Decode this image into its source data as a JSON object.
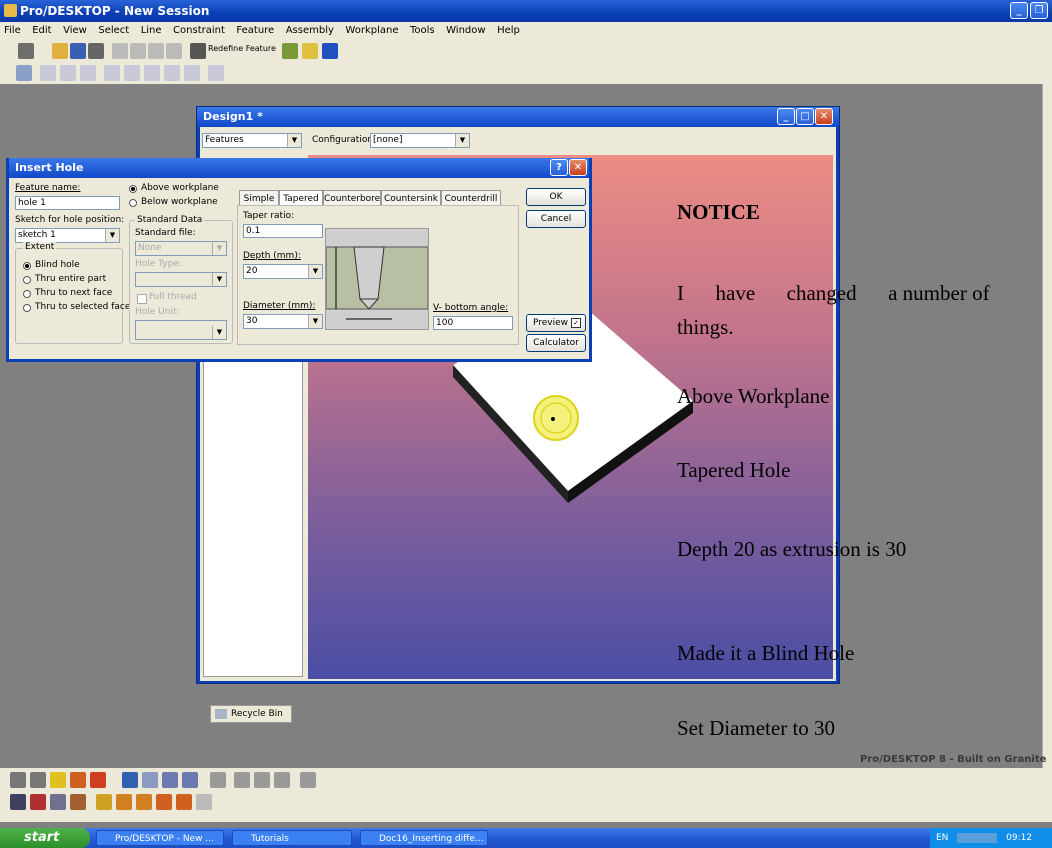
{
  "app": {
    "title": "Pro/DESKTOP - New Session"
  },
  "menu": [
    "File",
    "Edit",
    "View",
    "Select",
    "Line",
    "Constraint",
    "Feature",
    "Assembly",
    "Workplane",
    "Tools",
    "Window",
    "Help"
  ],
  "toolbar": {
    "redefine_label": "Redefine Feature"
  },
  "design_window": {
    "title": "Design1 *",
    "browser_select": "Features",
    "configuration_label": "Configuration:",
    "configuration_value": "[none]",
    "recycle_bin": "Recycle Bin"
  },
  "dialog": {
    "title": "Insert Hole",
    "feature_name_label": "Feature name:",
    "feature_name_value": "hole 1",
    "above_workplane": "Above workplane",
    "below_workplane": "Below workplane",
    "sketch_label": "Sketch for hole position:",
    "sketch_value": "sketch 1",
    "standard_data": "Standard Data",
    "standard_file": "Standard file:",
    "standard_file_value": "None",
    "hole_type": "Hole Type:",
    "full_thread": "Full thread",
    "hole_unit": "Hole Unit:",
    "extent": "Extent",
    "extent_options": [
      "Blind hole",
      "Thru entire part",
      "Thru to next face",
      "Thru to selected face"
    ],
    "tabs": [
      "Simple",
      "Tapered",
      "Counterbore",
      "Countersink",
      "Counterdrill"
    ],
    "taper_ratio_label": "Taper ratio:",
    "taper_ratio_value": "0.1",
    "depth_label": "Depth (mm):",
    "depth_value": "20",
    "diameter_label": "Diameter (mm):",
    "diameter_value": "30",
    "v_bottom_label": "V- bottom angle:",
    "v_bottom_value": "100",
    "ok": "OK",
    "cancel": "Cancel",
    "preview": "Preview",
    "calculator": "Calculator"
  },
  "notice": {
    "heading": "NOTICE",
    "lines": [
      "I      have      changed      a number of things.",
      "Above Workplane",
      "Tapered Hole",
      "Depth 20 as extrusion is 30",
      "Made it a Blind Hole",
      "Set Diameter to 30"
    ]
  },
  "brand": "Pro/DESKTOP 8 - Built on Granite",
  "taskbar": {
    "start": "start",
    "tasks": [
      "Pro/DESKTOP - New ...",
      "Tutorials",
      "Doc16_Inserting diffe..."
    ],
    "lang": "EN",
    "clock": "09:12"
  }
}
